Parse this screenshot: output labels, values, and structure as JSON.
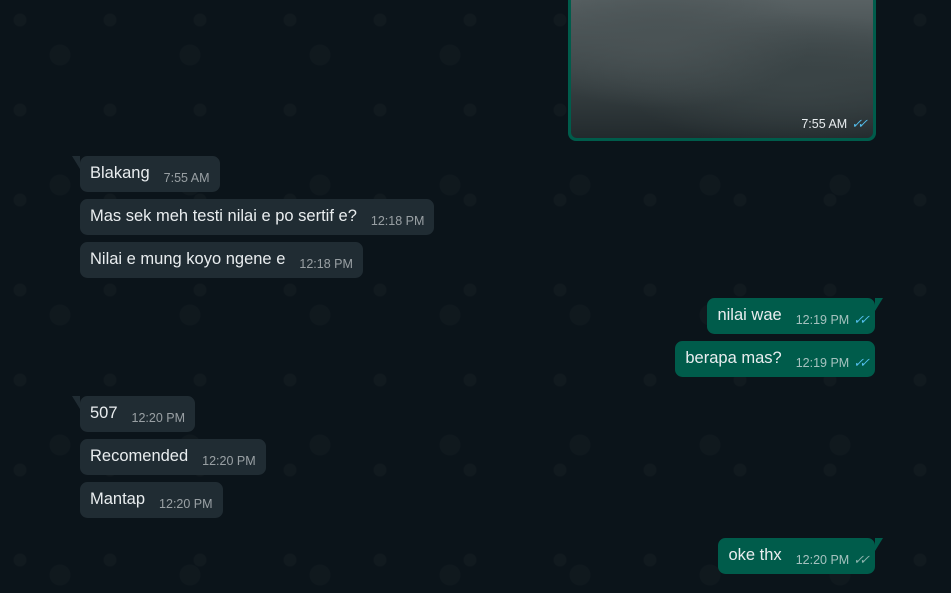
{
  "image_message": {
    "time": "7:55 AM",
    "ticks_icon": "double-check-blue"
  },
  "incoming_group_1": [
    {
      "text": "Blakang",
      "time": "7:55 AM"
    },
    {
      "text": "Mas sek meh testi nilai e po sertif e?",
      "time": "12:18 PM"
    },
    {
      "text": "Nilai e mung koyo ngene e",
      "time": "12:18 PM"
    }
  ],
  "outgoing_group_1": [
    {
      "text": "nilai wae",
      "time": "12:19 PM",
      "ticks_icon": "double-check-blue"
    },
    {
      "text": "berapa mas?",
      "time": "12:19 PM",
      "ticks_icon": "double-check-blue"
    }
  ],
  "incoming_group_2": [
    {
      "text": "507",
      "time": "12:20 PM"
    },
    {
      "text": "Recomended",
      "time": "12:20 PM"
    },
    {
      "text": "Mantap",
      "time": "12:20 PM"
    }
  ],
  "outgoing_group_2": [
    {
      "text": "oke thx",
      "time": "12:20 PM",
      "ticks_icon": "double-check-grey"
    }
  ],
  "colors": {
    "background": "#0b141a",
    "incoming_bubble": "#202c33",
    "outgoing_bubble": "#005c4b",
    "read_ticks": "#53bdeb"
  }
}
